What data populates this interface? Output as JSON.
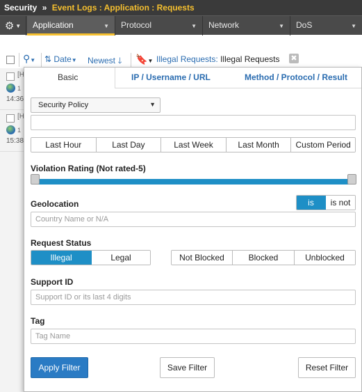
{
  "breadcrumb": {
    "root": "Security",
    "separator": "»",
    "page": "Event Logs : Application : Requests"
  },
  "nav": {
    "tabs": [
      {
        "label": "Application"
      },
      {
        "label": "Protocol"
      },
      {
        "label": "Network"
      },
      {
        "label": "DoS"
      }
    ]
  },
  "toolbar": {
    "sort_by": "Date",
    "order": "Newest",
    "filter_label": "Illegal Requests:",
    "filter_value": "Illegal Requests",
    "close": "✖"
  },
  "list": {
    "rows": [
      {
        "text": "[H",
        "geo": "1",
        "time": "14:36"
      },
      {
        "text": "[H",
        "geo": "1",
        "time": "15:38"
      }
    ]
  },
  "panel": {
    "tabs": [
      {
        "label": "Basic"
      },
      {
        "label": "IP / Username / URL"
      },
      {
        "label": "Method / Protocol / Result"
      }
    ],
    "security_policy": {
      "label": "Security Policy"
    },
    "time_ranges": [
      "Last Hour",
      "Last Day",
      "Last Week",
      "Last Month",
      "Custom Period"
    ],
    "violation_rating": {
      "label": "Violation Rating (Not rated-5)",
      "min": 0,
      "max": 5
    },
    "geolocation": {
      "label": "Geolocation",
      "is": "is",
      "is_not": "is not",
      "selected": "is",
      "placeholder": "Country Name or N/A"
    },
    "request_status": {
      "label": "Request Status",
      "legality": [
        "Illegal",
        "Legal"
      ],
      "legality_selected": "Illegal",
      "blocking": [
        "Not Blocked",
        "Blocked",
        "Unblocked"
      ]
    },
    "support_id": {
      "label": "Support ID",
      "placeholder": "Support ID or its last 4 digits"
    },
    "tag": {
      "label": "Tag",
      "placeholder": "Tag Name"
    },
    "buttons": {
      "apply": "Apply Filter",
      "save": "Save Filter",
      "reset": "Reset Filter"
    }
  },
  "colors": {
    "accent": "#1e8fc6",
    "nav_highlight": "#f6c02f",
    "link": "#2a6cb0",
    "primary_button": "#2a7bc4"
  }
}
